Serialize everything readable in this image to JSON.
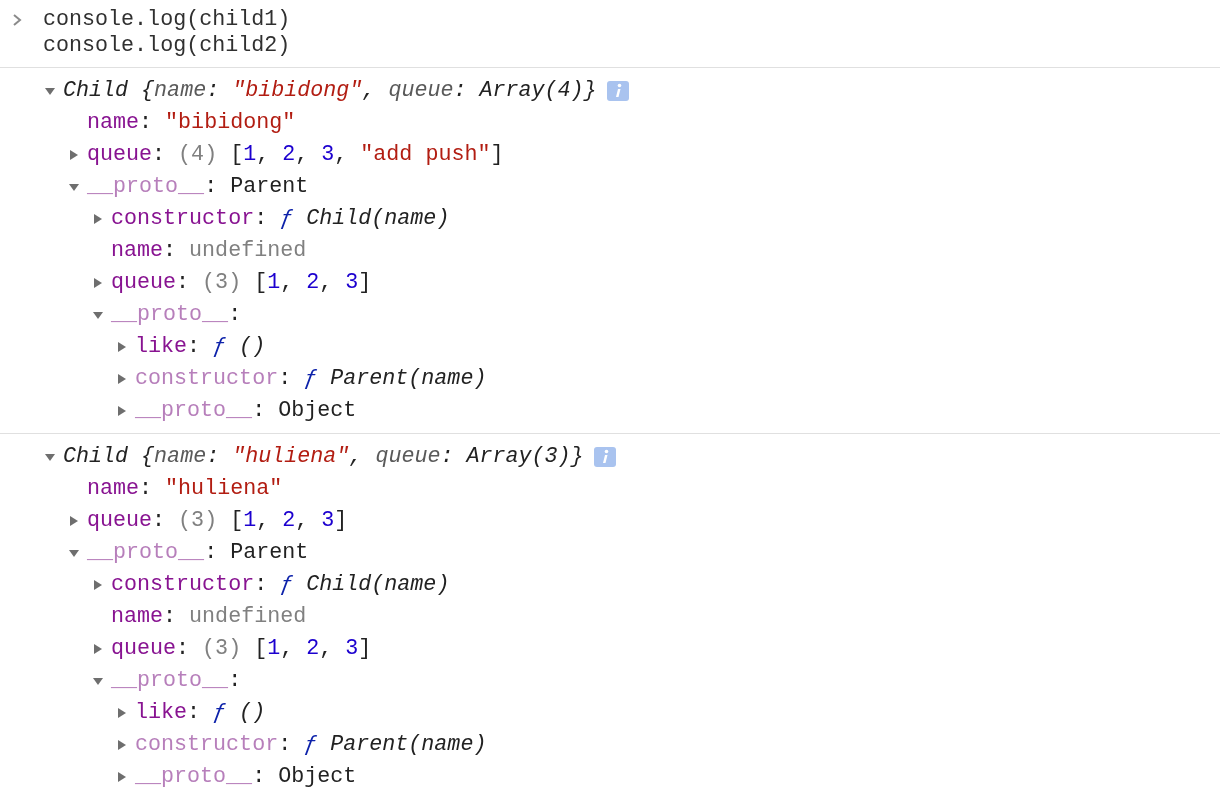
{
  "input": {
    "lines": [
      "console.log(child1)",
      "console.log(child2)"
    ]
  },
  "entries": [
    {
      "expanded": true,
      "summary": [
        {
          "text": "Child {",
          "kind": "italic"
        },
        {
          "text": "name",
          "kind": "italic_key"
        },
        {
          "text": ": ",
          "kind": "italic"
        },
        {
          "text": "\"bibidong\"",
          "kind": "italic_string"
        },
        {
          "text": ", ",
          "kind": "italic"
        },
        {
          "text": "queue",
          "kind": "italic_key"
        },
        {
          "text": ": ",
          "kind": "italic"
        },
        {
          "text": "Array(4)}",
          "kind": "italic"
        }
      ],
      "children": [
        {
          "kind": "leaf",
          "tokens": [
            {
              "text": "name",
              "kind": "key"
            },
            {
              "text": ": ",
              "kind": "plain"
            },
            {
              "text": "\"bibidong\"",
              "kind": "string"
            }
          ]
        },
        {
          "kind": "branch",
          "expanded": false,
          "tokens": [
            {
              "text": "queue",
              "kind": "key"
            },
            {
              "text": ": ",
              "kind": "plain"
            },
            {
              "text": "(4)",
              "kind": "gray"
            },
            {
              "text": " [",
              "kind": "plain"
            },
            {
              "text": "1",
              "kind": "number"
            },
            {
              "text": ", ",
              "kind": "plain"
            },
            {
              "text": "2",
              "kind": "number"
            },
            {
              "text": ", ",
              "kind": "plain"
            },
            {
              "text": "3",
              "kind": "number"
            },
            {
              "text": ", ",
              "kind": "plain"
            },
            {
              "text": "\"add push\"",
              "kind": "string"
            },
            {
              "text": "]",
              "kind": "plain"
            }
          ]
        },
        {
          "kind": "branch",
          "expanded": true,
          "tokens": [
            {
              "text": "__proto__",
              "kind": "key_dim"
            },
            {
              "text": ": Parent",
              "kind": "plain"
            }
          ],
          "children": [
            {
              "kind": "branch",
              "expanded": false,
              "tokens": [
                {
                  "text": "constructor",
                  "kind": "key"
                },
                {
                  "text": ": ",
                  "kind": "plain"
                },
                {
                  "text": "ƒ",
                  "kind": "func"
                },
                {
                  "text": " Child(name)",
                  "kind": "italic"
                }
              ]
            },
            {
              "kind": "leaf",
              "tokens": [
                {
                  "text": "name",
                  "kind": "key"
                },
                {
                  "text": ": ",
                  "kind": "plain"
                },
                {
                  "text": "undefined",
                  "kind": "gray"
                }
              ]
            },
            {
              "kind": "branch",
              "expanded": false,
              "tokens": [
                {
                  "text": "queue",
                  "kind": "key"
                },
                {
                  "text": ": ",
                  "kind": "plain"
                },
                {
                  "text": "(3)",
                  "kind": "gray"
                },
                {
                  "text": " [",
                  "kind": "plain"
                },
                {
                  "text": "1",
                  "kind": "number"
                },
                {
                  "text": ", ",
                  "kind": "plain"
                },
                {
                  "text": "2",
                  "kind": "number"
                },
                {
                  "text": ", ",
                  "kind": "plain"
                },
                {
                  "text": "3",
                  "kind": "number"
                },
                {
                  "text": "]",
                  "kind": "plain"
                }
              ]
            },
            {
              "kind": "branch",
              "expanded": true,
              "tokens": [
                {
                  "text": "__proto__",
                  "kind": "key_dim"
                },
                {
                  "text": ":",
                  "kind": "plain"
                }
              ],
              "children": [
                {
                  "kind": "branch",
                  "expanded": false,
                  "tokens": [
                    {
                      "text": "like",
                      "kind": "key"
                    },
                    {
                      "text": ": ",
                      "kind": "plain"
                    },
                    {
                      "text": "ƒ",
                      "kind": "func"
                    },
                    {
                      "text": " ()",
                      "kind": "italic"
                    }
                  ]
                },
                {
                  "kind": "branch",
                  "expanded": false,
                  "tokens": [
                    {
                      "text": "constructor",
                      "kind": "key_dim"
                    },
                    {
                      "text": ": ",
                      "kind": "plain"
                    },
                    {
                      "text": "ƒ",
                      "kind": "func"
                    },
                    {
                      "text": " Parent(name)",
                      "kind": "italic"
                    }
                  ]
                },
                {
                  "kind": "branch",
                  "expanded": false,
                  "tokens": [
                    {
                      "text": "__proto__",
                      "kind": "key_dim"
                    },
                    {
                      "text": ": Object",
                      "kind": "plain"
                    }
                  ]
                }
              ]
            }
          ]
        }
      ]
    },
    {
      "expanded": true,
      "summary": [
        {
          "text": "Child {",
          "kind": "italic"
        },
        {
          "text": "name",
          "kind": "italic_key"
        },
        {
          "text": ": ",
          "kind": "italic"
        },
        {
          "text": "\"huliena\"",
          "kind": "italic_string"
        },
        {
          "text": ", ",
          "kind": "italic"
        },
        {
          "text": "queue",
          "kind": "italic_key"
        },
        {
          "text": ": ",
          "kind": "italic"
        },
        {
          "text": "Array(3)}",
          "kind": "italic"
        }
      ],
      "children": [
        {
          "kind": "leaf",
          "tokens": [
            {
              "text": "name",
              "kind": "key"
            },
            {
              "text": ": ",
              "kind": "plain"
            },
            {
              "text": "\"huliena\"",
              "kind": "string"
            }
          ]
        },
        {
          "kind": "branch",
          "expanded": false,
          "tokens": [
            {
              "text": "queue",
              "kind": "key"
            },
            {
              "text": ": ",
              "kind": "plain"
            },
            {
              "text": "(3)",
              "kind": "gray"
            },
            {
              "text": " [",
              "kind": "plain"
            },
            {
              "text": "1",
              "kind": "number"
            },
            {
              "text": ", ",
              "kind": "plain"
            },
            {
              "text": "2",
              "kind": "number"
            },
            {
              "text": ", ",
              "kind": "plain"
            },
            {
              "text": "3",
              "kind": "number"
            },
            {
              "text": "]",
              "kind": "plain"
            }
          ]
        },
        {
          "kind": "branch",
          "expanded": true,
          "tokens": [
            {
              "text": "__proto__",
              "kind": "key_dim"
            },
            {
              "text": ": Parent",
              "kind": "plain"
            }
          ],
          "children": [
            {
              "kind": "branch",
              "expanded": false,
              "tokens": [
                {
                  "text": "constructor",
                  "kind": "key"
                },
                {
                  "text": ": ",
                  "kind": "plain"
                },
                {
                  "text": "ƒ",
                  "kind": "func"
                },
                {
                  "text": " Child(name)",
                  "kind": "italic"
                }
              ]
            },
            {
              "kind": "leaf",
              "tokens": [
                {
                  "text": "name",
                  "kind": "key"
                },
                {
                  "text": ": ",
                  "kind": "plain"
                },
                {
                  "text": "undefined",
                  "kind": "gray"
                }
              ]
            },
            {
              "kind": "branch",
              "expanded": false,
              "tokens": [
                {
                  "text": "queue",
                  "kind": "key"
                },
                {
                  "text": ": ",
                  "kind": "plain"
                },
                {
                  "text": "(3)",
                  "kind": "gray"
                },
                {
                  "text": " [",
                  "kind": "plain"
                },
                {
                  "text": "1",
                  "kind": "number"
                },
                {
                  "text": ", ",
                  "kind": "plain"
                },
                {
                  "text": "2",
                  "kind": "number"
                },
                {
                  "text": ", ",
                  "kind": "plain"
                },
                {
                  "text": "3",
                  "kind": "number"
                },
                {
                  "text": "]",
                  "kind": "plain"
                }
              ]
            },
            {
              "kind": "branch",
              "expanded": true,
              "tokens": [
                {
                  "text": "__proto__",
                  "kind": "key_dim"
                },
                {
                  "text": ":",
                  "kind": "plain"
                }
              ],
              "children": [
                {
                  "kind": "branch",
                  "expanded": false,
                  "tokens": [
                    {
                      "text": "like",
                      "kind": "key"
                    },
                    {
                      "text": ": ",
                      "kind": "plain"
                    },
                    {
                      "text": "ƒ",
                      "kind": "func"
                    },
                    {
                      "text": " ()",
                      "kind": "italic"
                    }
                  ]
                },
                {
                  "kind": "branch",
                  "expanded": false,
                  "tokens": [
                    {
                      "text": "constructor",
                      "kind": "key_dim"
                    },
                    {
                      "text": ": ",
                      "kind": "plain"
                    },
                    {
                      "text": "ƒ",
                      "kind": "func"
                    },
                    {
                      "text": " Parent(name)",
                      "kind": "italic"
                    }
                  ]
                },
                {
                  "kind": "branch",
                  "expanded": false,
                  "tokens": [
                    {
                      "text": "__proto__",
                      "kind": "key_dim"
                    },
                    {
                      "text": ": Object",
                      "kind": "plain"
                    }
                  ]
                }
              ]
            }
          ]
        }
      ]
    }
  ]
}
